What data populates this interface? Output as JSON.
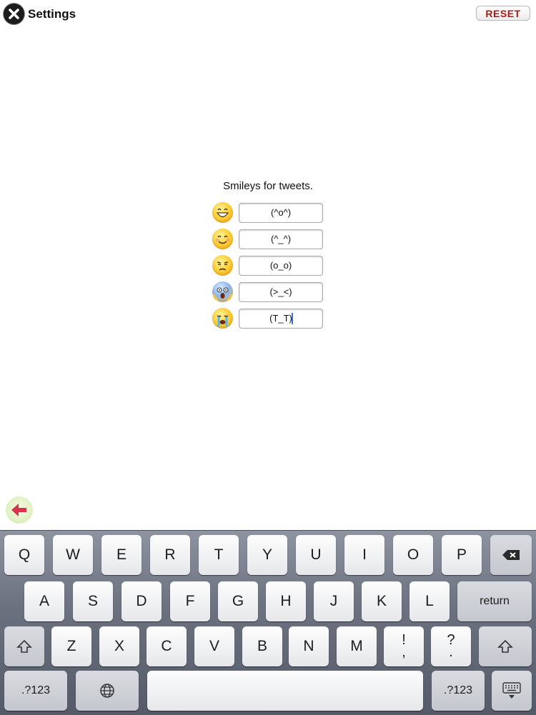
{
  "header": {
    "title": "Settings",
    "reset_label": "RESET",
    "close_icon": "close-icon"
  },
  "smileys": {
    "heading": "Smileys for tweets.",
    "items": [
      {
        "emoji": "grinning-face-icon",
        "value": "(^o^)"
      },
      {
        "emoji": "smiling-face-icon",
        "value": "(^_^)"
      },
      {
        "emoji": "unamused-face-icon",
        "value": "(o_o)"
      },
      {
        "emoji": "screaming-face-icon",
        "value": "(>_<)"
      },
      {
        "emoji": "crying-face-icon",
        "value": "(T_T)"
      }
    ]
  },
  "back": {
    "icon": "back-arrow-icon",
    "color": "#d8344b"
  },
  "keyboard": {
    "row1": [
      "Q",
      "W",
      "E",
      "R",
      "T",
      "Y",
      "U",
      "I",
      "O",
      "P"
    ],
    "row2": [
      "A",
      "S",
      "D",
      "F",
      "G",
      "H",
      "J",
      "K",
      "L"
    ],
    "return_label": "return",
    "row3": [
      "Z",
      "X",
      "C",
      "V",
      "B",
      "N",
      "M"
    ],
    "punct1": {
      "top": "!",
      "bottom": ","
    },
    "punct2": {
      "top": "?",
      "bottom": "."
    },
    "numbers_label": ".?123",
    "icons": [
      "backspace-icon",
      "shift-icon",
      "globe-icon",
      "hide-keyboard-icon"
    ]
  },
  "colors": {
    "reset_text": "#b01818",
    "caret": "#3a6ee0"
  }
}
